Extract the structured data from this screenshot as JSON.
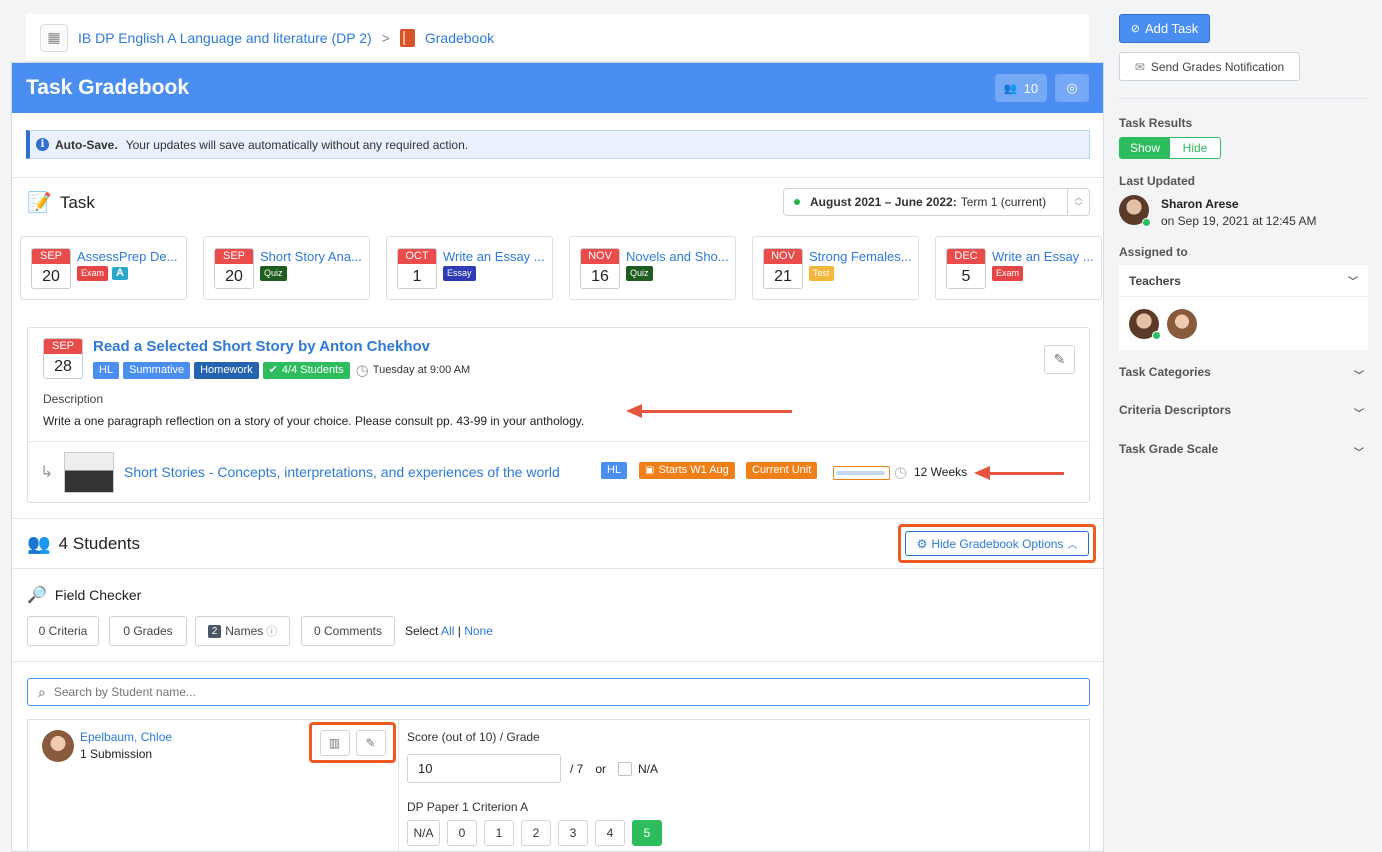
{
  "breadcrumb": {
    "course": "IB DP English A Language and literature (DP 2)",
    "separator": ">",
    "current": "Gradebook"
  },
  "banner": {
    "title": "Task Gradebook",
    "student_count": "10"
  },
  "autosave": {
    "label": "Auto-Save.",
    "message": "Your updates will save automatically without any required action."
  },
  "task_section": {
    "title": "Task",
    "term_bold": "August 2021 – June 2022:",
    "term_rest": "Term 1 (current)"
  },
  "task_cards": [
    {
      "month": "SEP",
      "day": "20",
      "title": "AssessPrep De...",
      "tags": [
        {
          "label": "Exam",
          "kind": "exam"
        },
        {
          "label": "A",
          "kind": "a"
        }
      ]
    },
    {
      "month": "SEP",
      "day": "20",
      "title": "Short Story Ana...",
      "tags": [
        {
          "label": "Quiz",
          "kind": "quiz"
        }
      ]
    },
    {
      "month": "OCT",
      "day": "1",
      "title": "Write an Essay ...",
      "tags": [
        {
          "label": "Essay",
          "kind": "essay"
        }
      ]
    },
    {
      "month": "NOV",
      "day": "16",
      "title": "Novels and Sho...",
      "tags": [
        {
          "label": "Quiz",
          "kind": "quiz"
        }
      ]
    },
    {
      "month": "NOV",
      "day": "21",
      "title": "Strong Females...",
      "tags": [
        {
          "label": "Test",
          "kind": "test"
        }
      ]
    },
    {
      "month": "DEC",
      "day": "5",
      "title": "Write an Essay ...",
      "tags": [
        {
          "label": "Exam",
          "kind": "exam"
        }
      ]
    }
  ],
  "task_detail": {
    "month": "SEP",
    "day": "28",
    "title": "Read a Selected Short Story by Anton Chekhov",
    "tags": [
      "HL",
      "Summative",
      "Homework"
    ],
    "students_tag": "4/4 Students",
    "due": "Tuesday at 9:00 AM",
    "description_label": "Description",
    "description": "Write a one paragraph reflection on a story of your choice. Please consult pp. 43-99 in your anthology."
  },
  "unit": {
    "title": "Short Stories - Concepts, interpretations, and experiences of the world",
    "level": "HL",
    "starts": "Starts W1 Aug",
    "current": "Current Unit",
    "progress": 0.92,
    "duration": "12 Weeks"
  },
  "students_section": {
    "title": "4 Students",
    "hide_options": "Hide Gradebook Options"
  },
  "field_checker": {
    "title": "Field Checker",
    "criteria": "0 Criteria",
    "grades": "0 Grades",
    "names_count": "2",
    "names": "Names",
    "comments": "0 Comments",
    "select_label": "Select",
    "all": "All",
    "sep": "|",
    "none": "None"
  },
  "search": {
    "placeholder": "Search by Student name..."
  },
  "student": {
    "name": "Epelbaum, Chloe",
    "submissions": "1 Submission",
    "score_label": "Score (out of 10) / Grade",
    "score_value": "10",
    "grade_suffix": "/ 7",
    "or": "or",
    "na": "N/A",
    "criterion_label": "DP Paper 1 Criterion A",
    "levels": [
      "N/A",
      "0",
      "1",
      "2",
      "3",
      "4",
      "5"
    ],
    "selected_level": "5"
  },
  "sidebar": {
    "add_task": "Add Task",
    "send_notification": "Send Grades Notification",
    "task_results": "Task Results",
    "show": "Show",
    "hide": "Hide",
    "last_updated": "Last Updated",
    "updater_name": "Sharon Arese",
    "updated_on": "on Sep 19, 2021 at 12:45 AM",
    "assigned_to": "Assigned to",
    "teachers": "Teachers",
    "task_categories": "Task Categories",
    "criteria_descriptors": "Criteria Descriptors",
    "task_grade_scale": "Task Grade Scale"
  },
  "colors": {
    "accent": "#4a8ef2",
    "highlight": "#ef5a23",
    "success": "#2dbd5c"
  }
}
